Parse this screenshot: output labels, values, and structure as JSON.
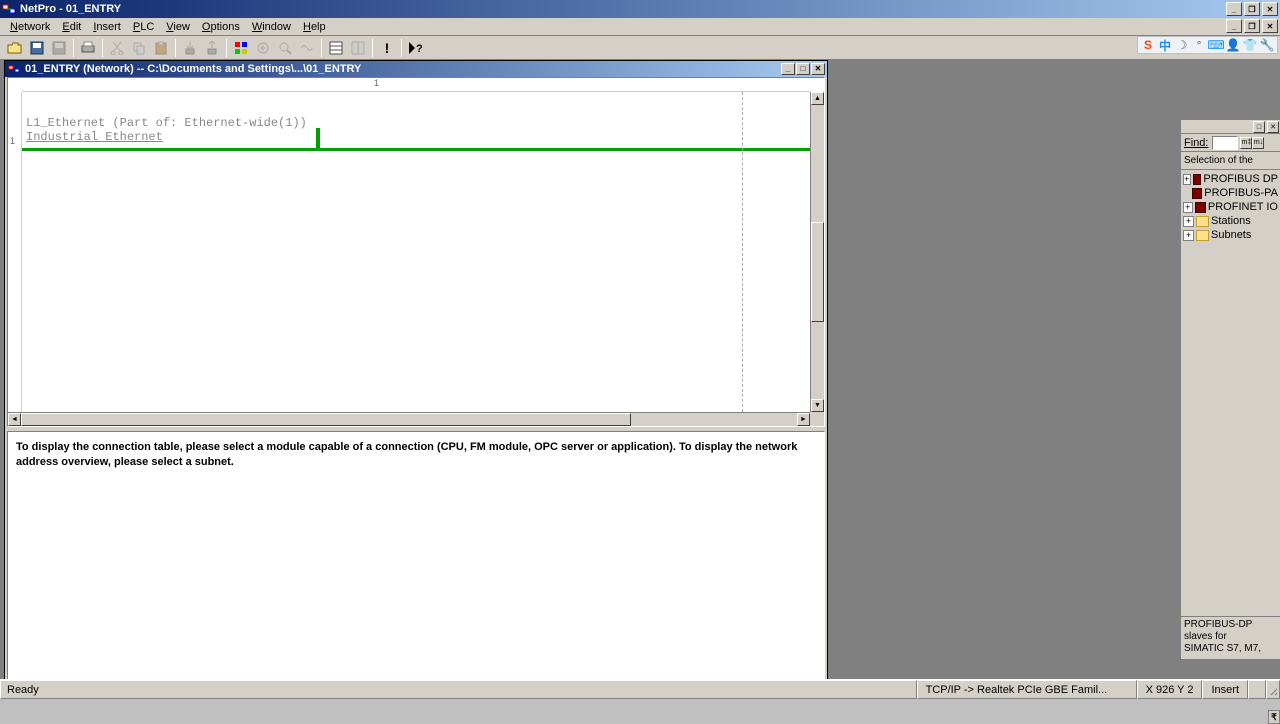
{
  "title": "NetPro - 01_ENTRY",
  "menu": {
    "network": "Network",
    "edit": "Edit",
    "insert": "Insert",
    "plc": "PLC",
    "view": "View",
    "options": "Options",
    "window": "Window",
    "help": "Help"
  },
  "child": {
    "title": "01_ENTRY (Network) -- C:\\Documents and Settings\\...\\01_ENTRY"
  },
  "ruler": {
    "h1": "1",
    "v1": "1"
  },
  "diagram": {
    "line1": "L1_Ethernet (Part of: Ethernet-wide(1))",
    "line2": "Industrial Ethernet"
  },
  "info": "To display the connection table, please select a module capable of a connection (CPU, FM module, OPC server or application). To display the network address overview, please select a subnet.",
  "sidebar": {
    "find": "Find:",
    "placeholder": "",
    "selection": "Selection of the",
    "tree": [
      {
        "exp": "+",
        "type": "net",
        "label": "PROFIBUS DP"
      },
      {
        "exp": "",
        "type": "net",
        "label": "PROFIBUS-PA"
      },
      {
        "exp": "+",
        "type": "net",
        "label": "PROFINET IO"
      },
      {
        "exp": "+",
        "type": "folder",
        "label": "Stations"
      },
      {
        "exp": "+",
        "type": "folder",
        "label": "Subnets"
      }
    ],
    "desc1": "PROFIBUS-DP",
    "desc2": "slaves for",
    "desc3": "SIMATIC S7, M7,"
  },
  "status": {
    "ready": "Ready",
    "net": "TCP/IP -> Realtek PCIe GBE Famil...",
    "coords": "X 926  Y 2",
    "insert": "Insert"
  },
  "tray": {
    "i1": "S",
    "i2": "中",
    "i3": "☽",
    "i4": "°",
    "i5": "⌨",
    "i6": "👤",
    "i7": "👕",
    "i8": "🔧"
  },
  "colors": {
    "ethernet": "#00a000"
  }
}
